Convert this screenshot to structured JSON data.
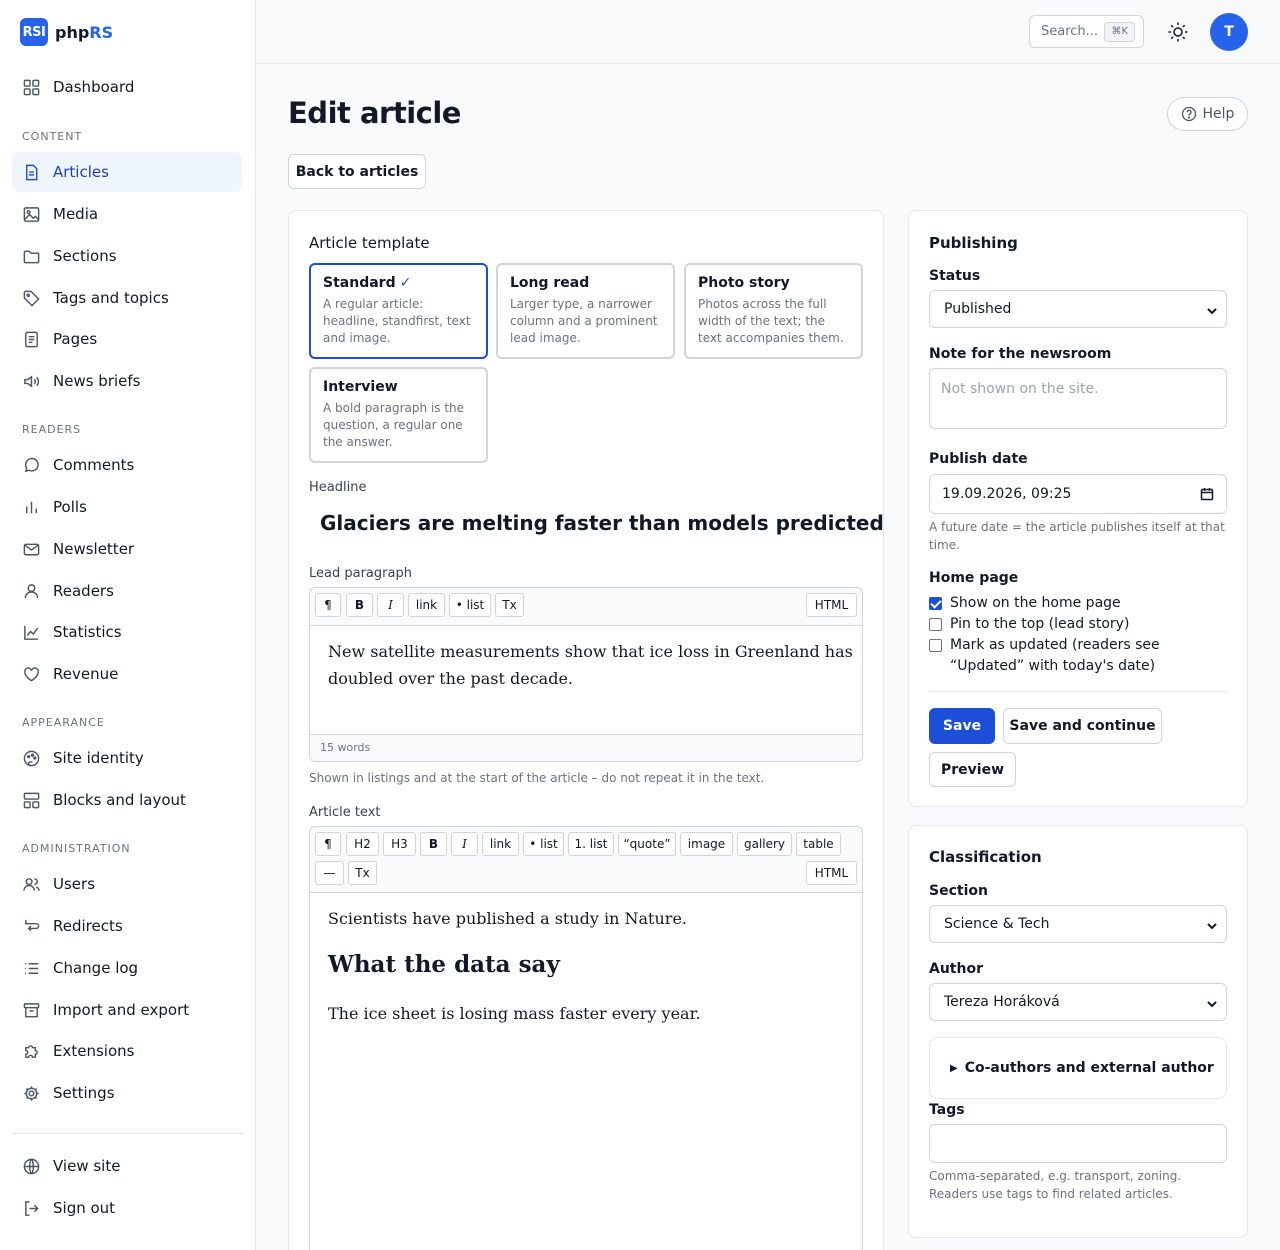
{
  "brand": {
    "mark": "RSI",
    "name_a": "php",
    "name_b": "RS"
  },
  "topbar": {
    "search_placeholder": "Search...",
    "search_shortcut": "⌘K",
    "avatar_initial": "T"
  },
  "nav": {
    "dashboard": "Dashboard",
    "groups": {
      "content": "CONTENT",
      "readers": "READERS",
      "appearance": "APPEARANCE",
      "administration": "ADMINISTRATION"
    },
    "articles": "Articles",
    "media": "Media",
    "sections": "Sections",
    "tags": "Tags and topics",
    "pages": "Pages",
    "news_briefs": "News briefs",
    "comments": "Comments",
    "polls": "Polls",
    "newsletter": "Newsletter",
    "readers": "Readers",
    "statistics": "Statistics",
    "revenue": "Revenue",
    "site_identity": "Site identity",
    "blocks": "Blocks and layout",
    "users": "Users",
    "redirects": "Redirects",
    "change_log": "Change log",
    "import_export": "Import and export",
    "extensions": "Extensions",
    "settings": "Settings",
    "view_site": "View site",
    "sign_out": "Sign out"
  },
  "page": {
    "title": "Edit article",
    "help": "Help",
    "back": "Back to articles"
  },
  "template": {
    "label": "Article template",
    "options": [
      {
        "title": "Standard",
        "check": "✓",
        "desc": "A regular article: headline, standfirst, text and image."
      },
      {
        "title": "Long read",
        "desc": "Larger type, a narrower column and a prominent lead image."
      },
      {
        "title": "Photo story",
        "desc": "Photos across the full width of the text; the text accompanies them."
      },
      {
        "title": "Interview",
        "desc": "A bold paragraph is the question, a regular one the answer."
      }
    ]
  },
  "headline": {
    "label": "Headline",
    "value": "Glaciers are melting faster than models predicted"
  },
  "lead": {
    "label": "Lead paragraph",
    "toolbar": [
      "¶",
      "B",
      "I",
      "link",
      "• list",
      "Tx"
    ],
    "html": "HTML",
    "text": "New satellite measurements show that ice loss in Greenland has doubled over the past decade.",
    "word_count": "15 words",
    "hint": "Shown in listings and at the start of the article – do not repeat it in the text."
  },
  "body": {
    "label": "Article text",
    "toolbar": [
      "¶",
      "H2",
      "H3",
      "B",
      "I",
      "link",
      "• list",
      "1. list",
      "“quote”",
      "image",
      "gallery",
      "table",
      "—",
      "Tx"
    ],
    "html": "HTML",
    "p1": "Scientists have published a study in Nature.",
    "h2": "What the data say",
    "p2": "The ice sheet is losing mass faster every year."
  },
  "publishing": {
    "title": "Publishing",
    "status_label": "Status",
    "status_value": "Published",
    "note_label": "Note for the newsroom",
    "note_placeholder": "Not shown on the site.",
    "date_label": "Publish date",
    "date_value": "19.09.2026, 09:25",
    "date_hint": "A future date = the article publishes itself at that time.",
    "home_label": "Home page",
    "opt_show": "Show on the home page",
    "opt_pin": "Pin to the top (lead story)",
    "opt_updated": "Mark as updated (readers see “Updated” with today's date)",
    "save": "Save",
    "save_continue": "Save and continue",
    "preview": "Preview"
  },
  "classification": {
    "title": "Classification",
    "section_label": "Section",
    "section_value": "Science & Tech",
    "author_label": "Author",
    "author_value": "Tereza Horáková",
    "coauthors": "Co-authors and external author",
    "tags_label": "Tags",
    "tags_hint": "Comma-separated, e.g. transport, zoning. Readers use tags to find related articles."
  },
  "colors": {
    "accent": "#1d4ed8",
    "brand": "#2563eb",
    "active_bg": "#eff6ff"
  }
}
